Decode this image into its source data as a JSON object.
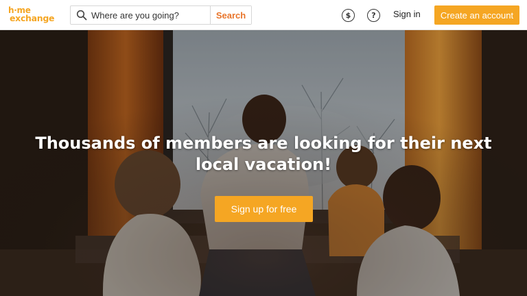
{
  "header": {
    "logo": {
      "line1": "h·me",
      "line2": "exchange"
    },
    "search": {
      "placeholder": "Where are you going?",
      "button_label": "Search"
    },
    "currency_icon": "dollar-icon",
    "currency_glyph": "$",
    "help_icon": "question-icon",
    "help_glyph": "?",
    "signin_label": "Sign in",
    "create_account_label": "Create an account"
  },
  "hero": {
    "headline": "Thousands of members are looking for their next local vacation!",
    "cta_label": "Sign up for free",
    "image": "family-at-window-photo"
  },
  "colors": {
    "brand": "#f5a623",
    "search_accent": "#e8742a",
    "header_bg": "#ffffff",
    "hero_text": "#ffffff"
  }
}
